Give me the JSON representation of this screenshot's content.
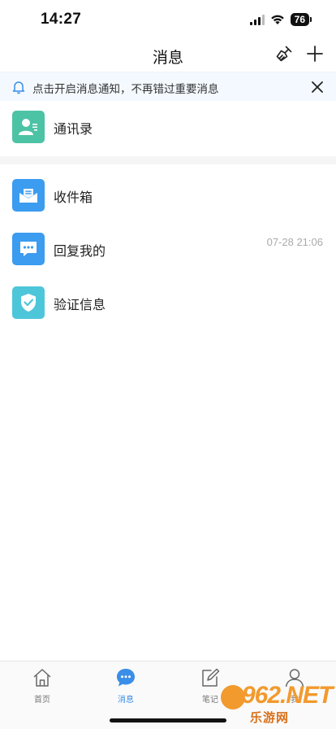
{
  "status_bar": {
    "time": "14:27",
    "battery": "76"
  },
  "header": {
    "title": "消息"
  },
  "notice": {
    "text": "点击开启消息通知，不再错过重要消息"
  },
  "contacts": {
    "label": "通讯录"
  },
  "messages": [
    {
      "label": "收件箱",
      "time": ""
    },
    {
      "label": "回复我的",
      "time": "07-28 21:06"
    },
    {
      "label": "验证信息",
      "time": ""
    }
  ],
  "tabs": [
    {
      "label": "首页",
      "icon": "home-icon"
    },
    {
      "label": "消息",
      "icon": "chat-bubble-icon",
      "active": true
    },
    {
      "label": "笔记",
      "icon": "note-edit-icon"
    },
    {
      "label": "我",
      "icon": "person-icon"
    }
  ],
  "watermark": {
    "big": "962.NET",
    "small": "乐游网"
  },
  "colors": {
    "accent": "#3a8ee8",
    "contacts_icon": "#4cc3a4",
    "inbox_icon": "#3b9cf0",
    "reply_icon": "#3b9cf0",
    "verify_icon": "#4ec6d9",
    "notice_bg": "#f4f9ff"
  }
}
